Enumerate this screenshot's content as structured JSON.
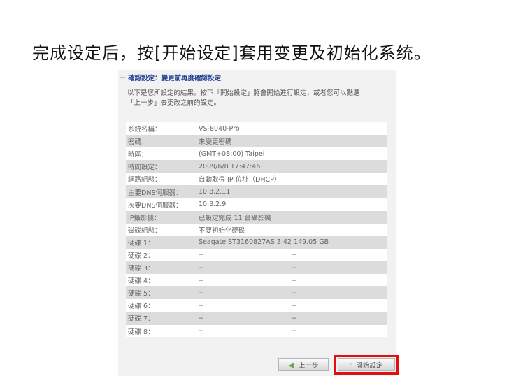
{
  "slide_title": "完成设定后，按[开始设定]套用变更及初始化系统。",
  "panel": {
    "section_title": "確認設定：變更前再度確認設定",
    "intro_line1": "以下是您所設定的結果。按下「開始設定」將會開始進行設定，或者您可以點選",
    "intro_line2": "「上一步」去更改之前的設定。",
    "rows": [
      {
        "label": "系統名稱：",
        "value": "VS-8040-Pro",
        "value2": ""
      },
      {
        "label": "密碼：",
        "value": "未變更密碼",
        "value2": ""
      },
      {
        "label": "時區：",
        "value": "(GMT+08:00) Taipei",
        "value2": ""
      },
      {
        "label": "時間設定：",
        "value": "2009/6/8 17:47:46",
        "value2": ""
      },
      {
        "label": "網路組態：",
        "value": "自動取得 IP 位址（DHCP）",
        "value2": ""
      },
      {
        "label": "主要DNS伺服器：",
        "value": "10.8.2.11",
        "value2": ""
      },
      {
        "label": "次要DNS伺服器：",
        "value": "10.8.2.9",
        "value2": ""
      },
      {
        "label": "IP攝影機：",
        "value": "已設定完成 11 台攝影機",
        "value2": ""
      },
      {
        "label": "磁碟組態：",
        "value": "不要初始化硬碟",
        "value2": ""
      },
      {
        "label": "硬碟 1：",
        "value": "Seagate ST3160827AS 3.42  149.05 GB",
        "value2": ""
      },
      {
        "label": "硬碟 2：",
        "value": "--",
        "value2": "--"
      },
      {
        "label": "硬碟 3：",
        "value": "--",
        "value2": "--"
      },
      {
        "label": "硬碟 4：",
        "value": "--",
        "value2": "--"
      },
      {
        "label": "硬碟 5：",
        "value": "--",
        "value2": "--"
      },
      {
        "label": "硬碟 6：",
        "value": "--",
        "value2": "--"
      },
      {
        "label": "硬碟 7：",
        "value": "--",
        "value2": "--"
      },
      {
        "label": "硬碟 8：",
        "value": "--",
        "value2": "--"
      }
    ],
    "back_label": "上一步",
    "start_label": "開始設定"
  }
}
